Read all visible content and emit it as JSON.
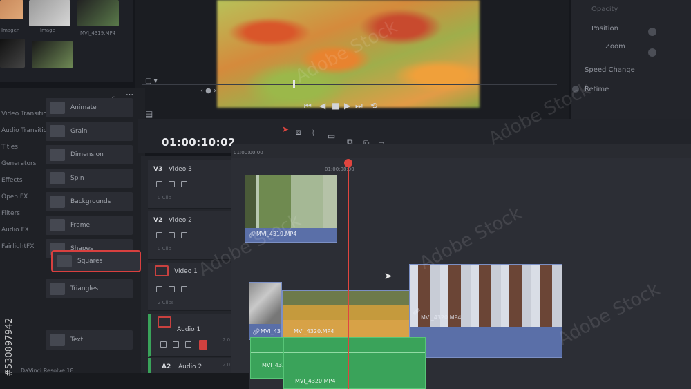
{
  "media_pool": {
    "captions": [
      "Imagen",
      "Image",
      "MVI_4319.MP4"
    ]
  },
  "viewer": {
    "controls": {
      "skip_back": "⏮",
      "step_back": "◀",
      "stop": "■",
      "play": "▶",
      "skip_forward": "⏭",
      "loop": "⟲"
    }
  },
  "inspector": {
    "rows": [
      "Opacity",
      "Position",
      "Zoom",
      "Speed Change",
      "Retime"
    ]
  },
  "effects": {
    "categories": [
      "Video Transitions",
      "Audio Transitions",
      "Titles",
      "Generators",
      "Effects",
      "Open FX",
      "Filters",
      "Audio FX",
      "FairlightFX"
    ],
    "items": [
      "Animate",
      "Grain",
      "Dimension",
      "Spin",
      "Backgrounds",
      "Frame",
      "Shapes",
      "Squares",
      "Triangles",
      "Text"
    ],
    "selected_index": 7
  },
  "timeline": {
    "timecode": "01:00:10:02",
    "ruler_labels": [
      "01:00:00:00",
      "01:00:08:00"
    ],
    "tracks": [
      {
        "id": "V3",
        "name": "Video 3",
        "sub": "0 Clip"
      },
      {
        "id": "V2",
        "name": "Video 2",
        "sub": "0 Clip"
      },
      {
        "id": "V1",
        "name": "Video 1",
        "sub": "2 Clips"
      },
      {
        "id": "A1",
        "name": "Audio 1",
        "sub": "2.0"
      },
      {
        "id": "A2",
        "name": "Audio 2",
        "sub": "2.0"
      }
    ],
    "clips": {
      "v2_clip": "MVI_4319.MP4",
      "v1_clip_a": "MVI_43...",
      "v1_clip_b": "MVI_4320.MP4",
      "v1_clip_c": "MVI_4320.MP4",
      "a1_clip_a": "MVI_43...",
      "a1_clip_b": "MVI_4320.MP4"
    }
  },
  "footer": {
    "text": "DaVinci Resolve 18"
  },
  "watermark": {
    "text": "Adobe Stock",
    "id": "#530897942"
  },
  "colors": {
    "accent_red": "#e0453f",
    "clip_blue": "#5a6fa8",
    "audio_green": "#3aa35a"
  }
}
